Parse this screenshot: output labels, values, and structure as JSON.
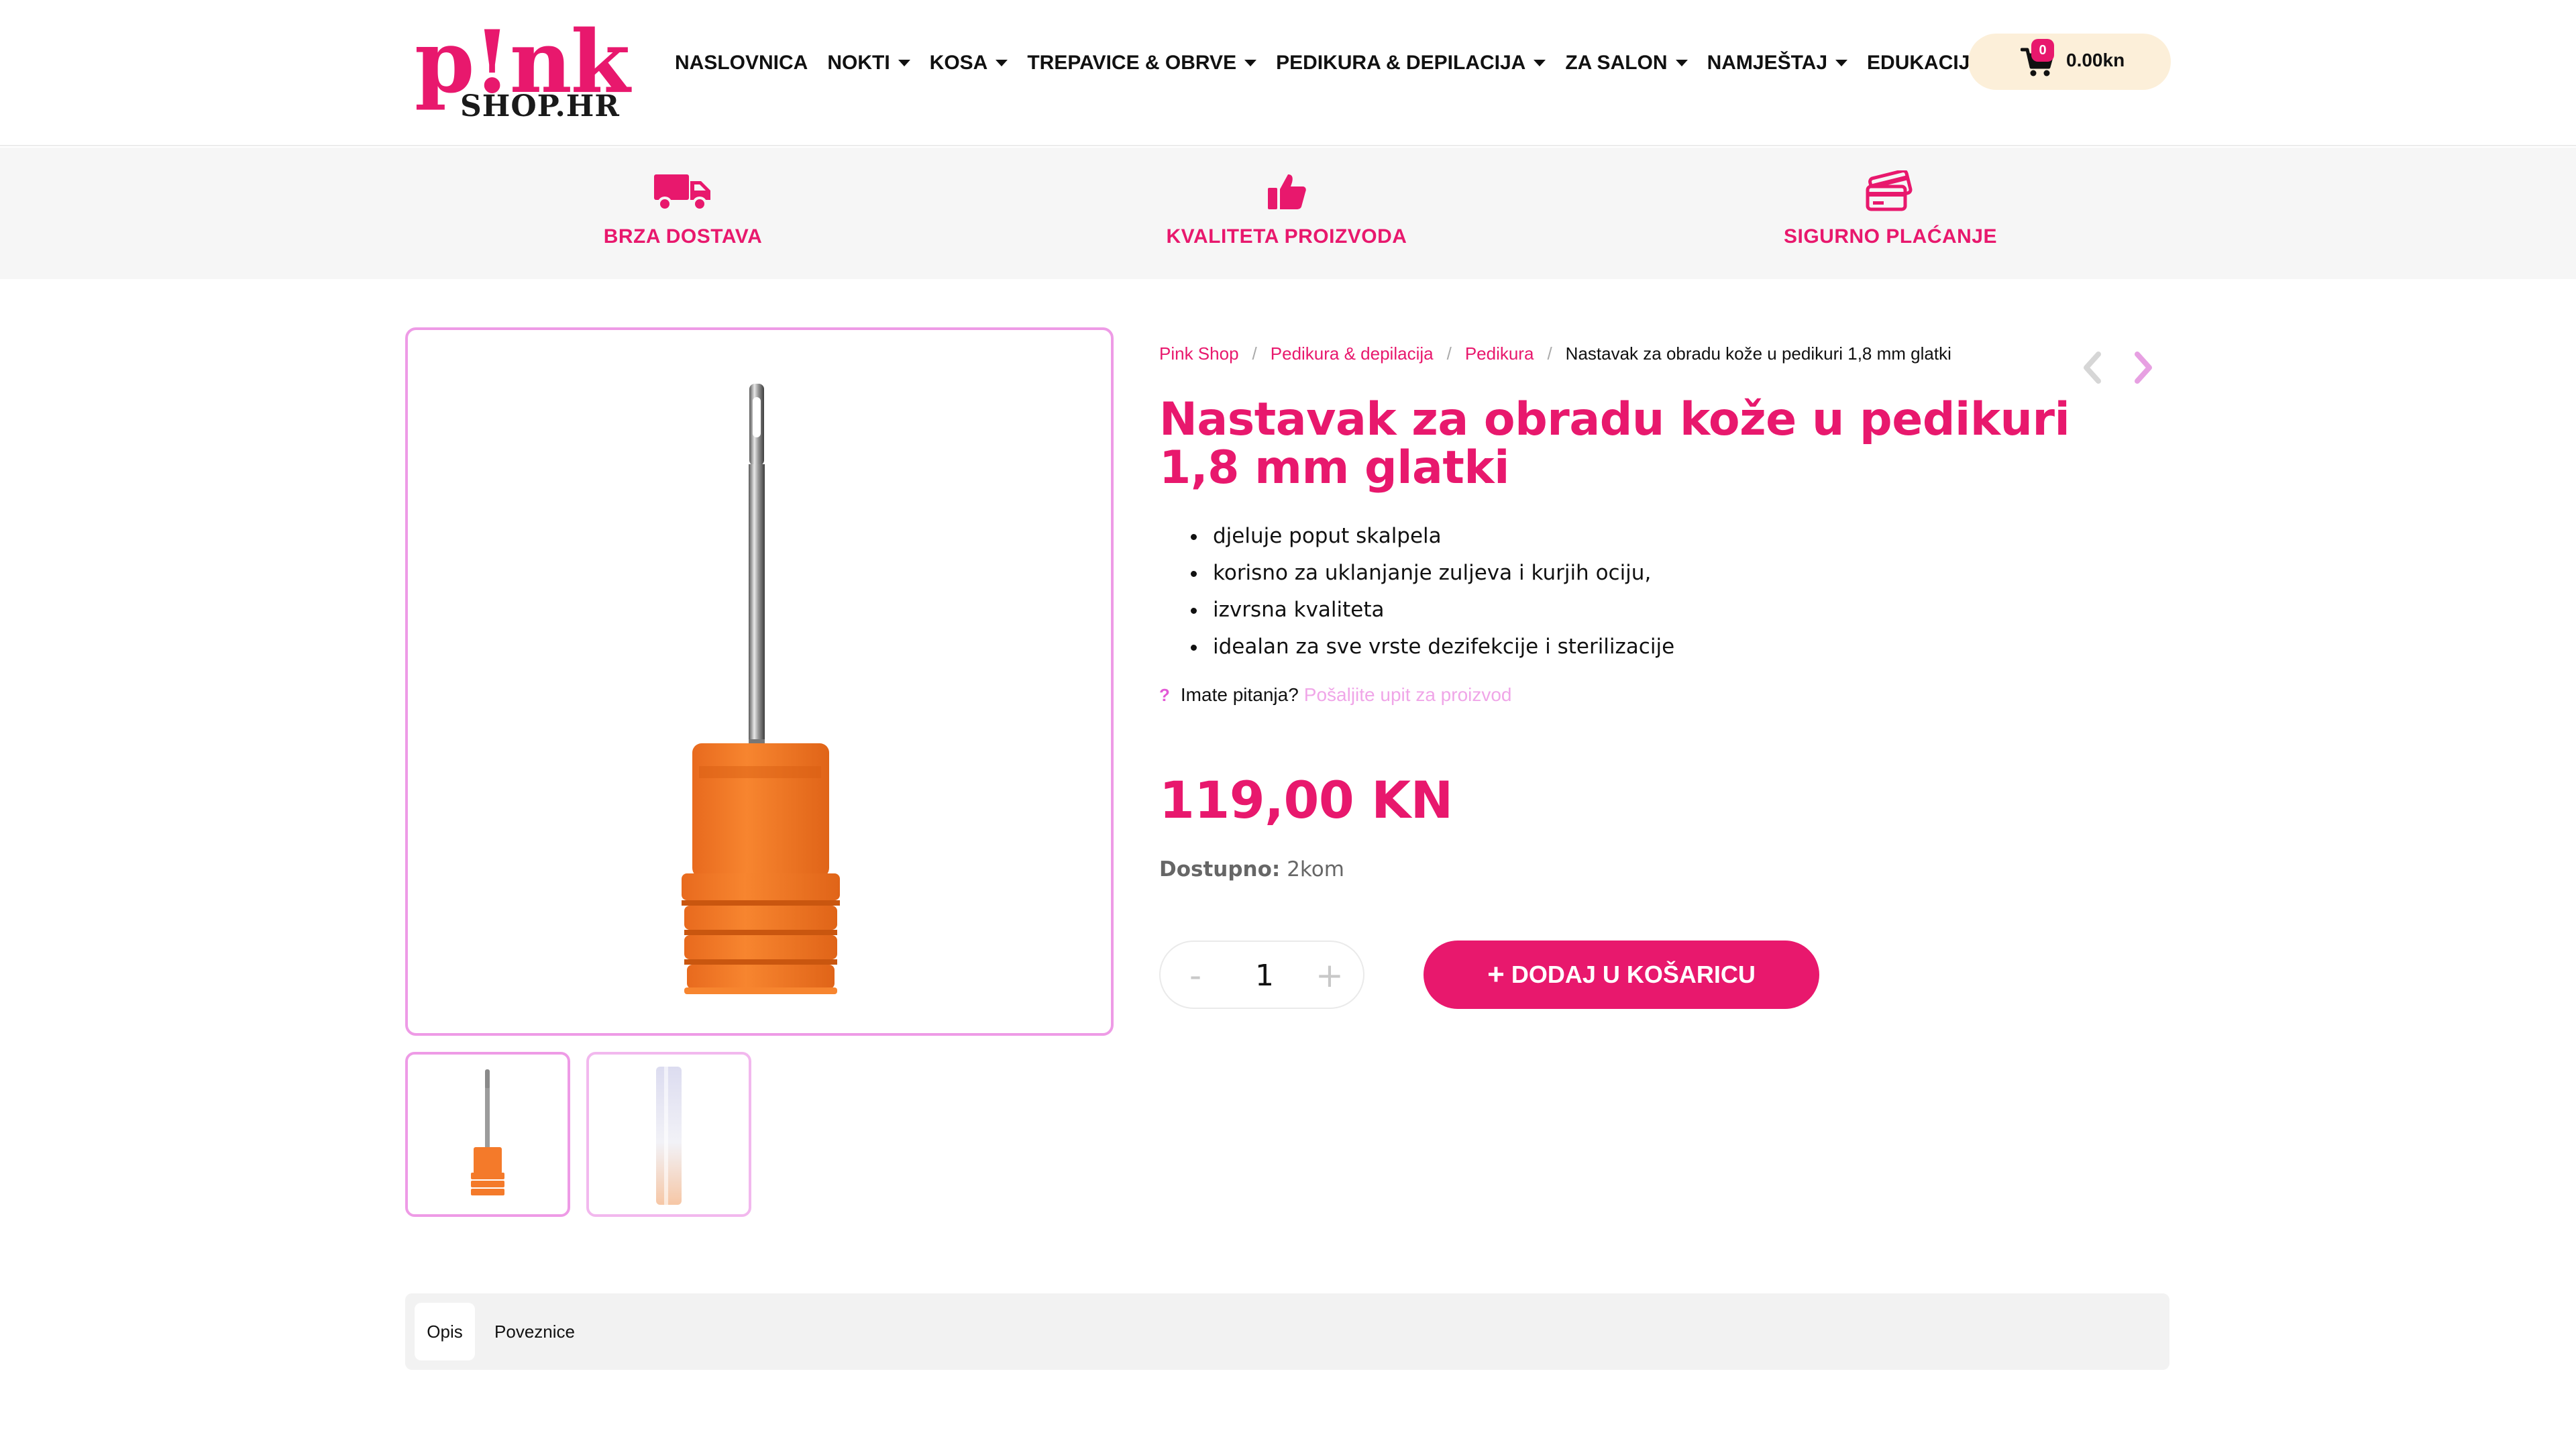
{
  "header": {
    "logo": {
      "main": "p!nk",
      "sub": "SHOP.HR"
    },
    "nav": [
      {
        "label": "NASLOVNICA",
        "dropdown": false
      },
      {
        "label": "NOKTI",
        "dropdown": true
      },
      {
        "label": "KOSA",
        "dropdown": true
      },
      {
        "label": "TREPAVICE & OBRVE",
        "dropdown": true
      },
      {
        "label": "PEDIKURA & DEPILACIJA",
        "dropdown": true
      },
      {
        "label": "ZA SALON",
        "dropdown": true
      },
      {
        "label": "NAMJEŠTAJ",
        "dropdown": true
      },
      {
        "label": "EDUKACIJE",
        "dropdown": true
      }
    ],
    "cart": {
      "count": "0",
      "total": "0.00kn"
    }
  },
  "features": [
    {
      "label": "BRZA DOSTAVA",
      "icon": "truck-icon"
    },
    {
      "label": "KVALITETA PROIZVODA",
      "icon": "thumbs-up-icon"
    },
    {
      "label": "SIGURNO PLAĆANJE",
      "icon": "credit-cards-icon"
    }
  ],
  "breadcrumb": {
    "items": [
      "Pink Shop",
      "Pedikura & depilacija",
      "Pedikura"
    ],
    "current": "Nastavak za obradu kože u pedikuri 1,8 mm glatki"
  },
  "product": {
    "title": "Nastavak za obradu kože u pedikuri 1,8 mm glatki",
    "features": [
      "djeluje poput skalpela",
      "korisno za uklanjanje zuljeva i kurjih ociju,",
      "izvrsna kvaliteta",
      "idealan za sve vrste dezifekcije i sterilizacije"
    ],
    "question_mark": "?",
    "question": "Imate pitanja?",
    "question_link": "Pošaljite upit za proizvod",
    "price": "119,00 KN",
    "stock_label": "Dostupno:",
    "stock_value": "2kom",
    "quantity": "1",
    "qty_minus": "-",
    "qty_plus": "+",
    "add_plus": "+",
    "add_to_cart": "DODAJ U KOŠARICU"
  },
  "tabs": [
    "Opis",
    "Poveznice"
  ],
  "colors": {
    "brand_pink": "#e8186d",
    "border_pink": "#ee9be6",
    "cart_bg": "#fcefd9",
    "product_orange": "#f47a2a"
  }
}
